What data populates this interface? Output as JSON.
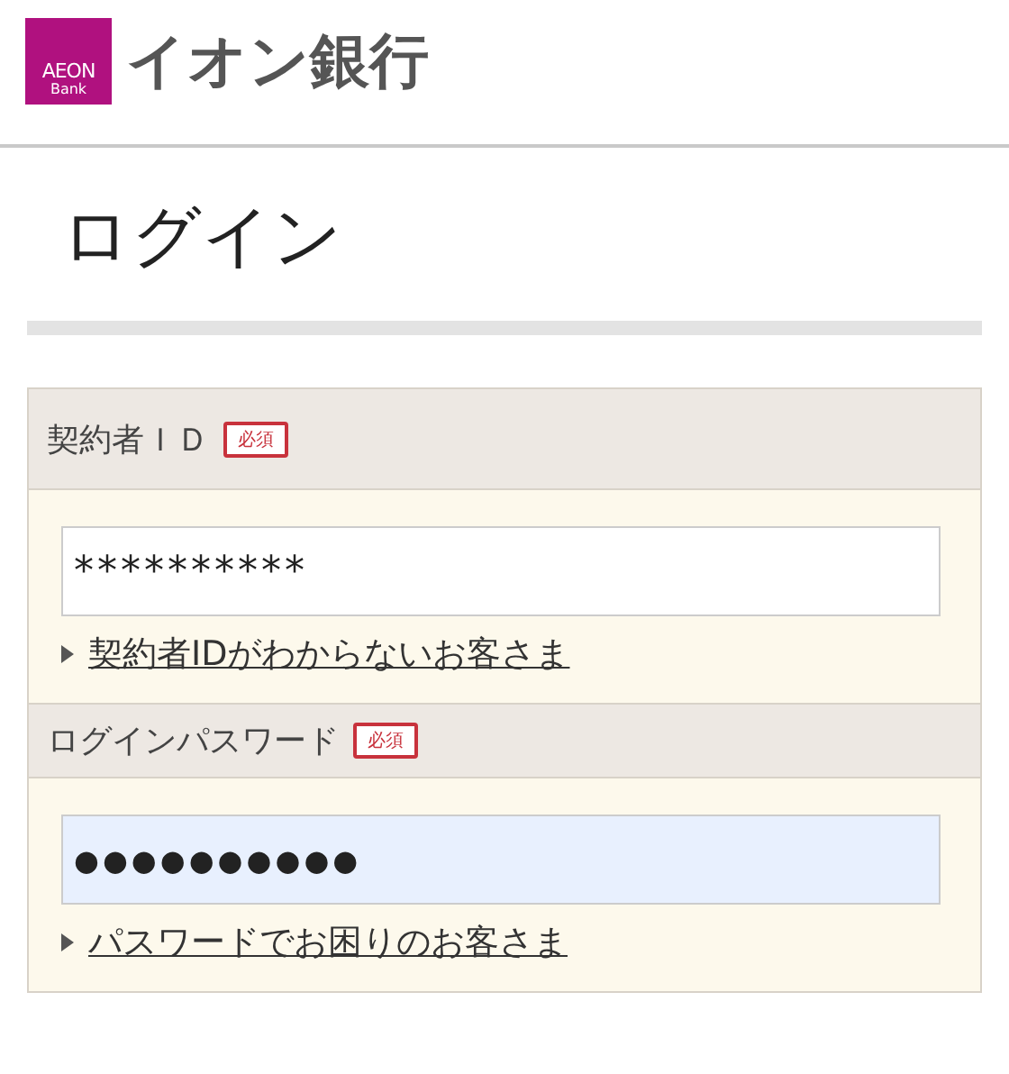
{
  "header": {
    "logo": {
      "top": "AEON",
      "bottom": "Bank"
    },
    "brand": "イオン銀行"
  },
  "page_title": "ログイン",
  "fields": [
    {
      "label": "契約者ＩＤ",
      "badge": "必須",
      "value": "**********",
      "highlighted": false,
      "link": "契約者IDがわからないお客さま"
    },
    {
      "label": "ログインパスワード",
      "badge": "必須",
      "value": "●●●●●●●●●●",
      "highlighted": true,
      "link": "パスワードでお困りのお客さま"
    }
  ]
}
